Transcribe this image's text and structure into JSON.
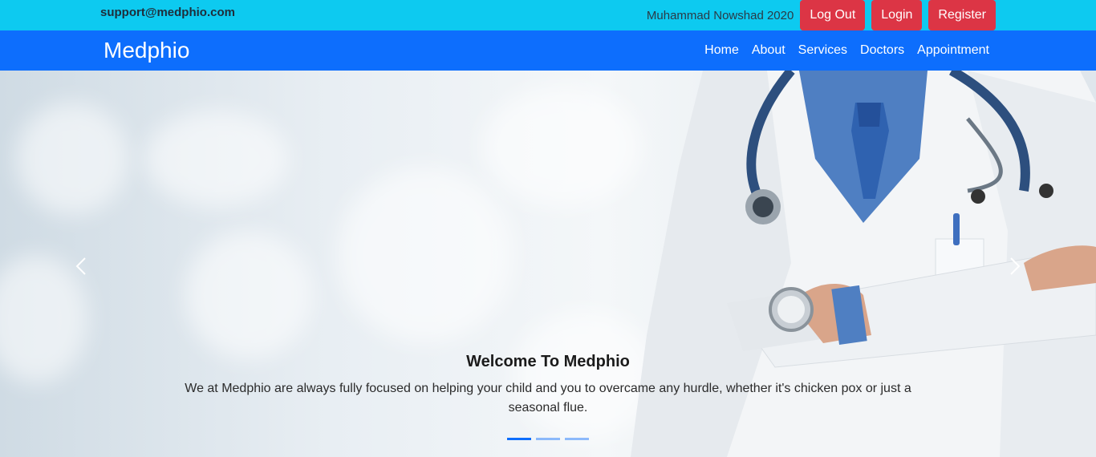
{
  "topbar": {
    "email": "support@medphio.com",
    "user": "Muhammad Nowshad 2020",
    "logout_label": "Log Out",
    "login_label": "Login",
    "register_label": "Register"
  },
  "navbar": {
    "brand": "Medphio",
    "links": [
      "Home",
      "About",
      "Services",
      "Doctors",
      "Appointment"
    ]
  },
  "hero": {
    "title": "Welcome To Medphio",
    "text": "We at Medphio are always fully focused on helping your child and you to overcame any hurdle, whether it's chicken pox or just a seasonal flue.",
    "slides": 3,
    "active_slide": 1
  },
  "colors": {
    "topbar": "#0dcaf0",
    "navbar": "#0d6efd",
    "button": "#dc3545"
  }
}
